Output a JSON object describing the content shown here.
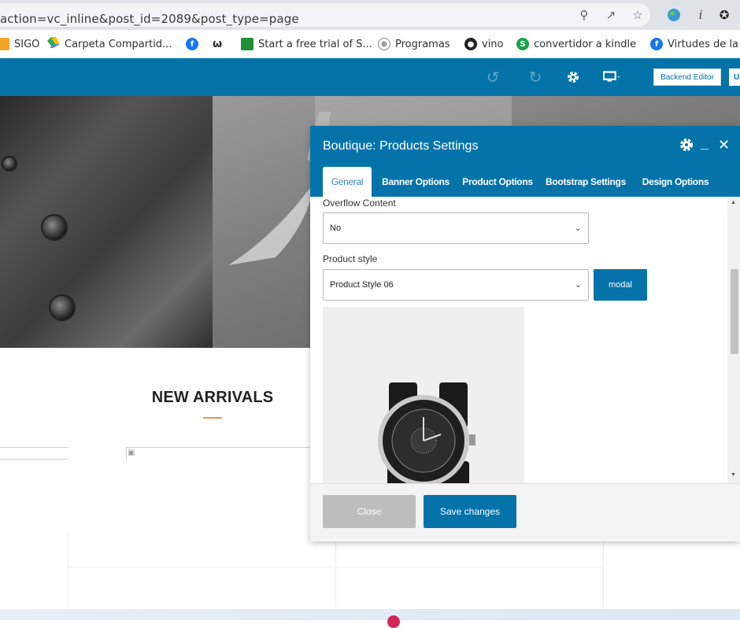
{
  "browser": {
    "url": "action=vc_inline&post_id=2089&post_type=page",
    "bookmarks": [
      {
        "label": "SIGO",
        "icon": "bookmark-icon"
      },
      {
        "label": "Carpeta Compartid...",
        "icon": "google-drive-icon"
      },
      {
        "label": "",
        "icon": "facebook-icon"
      },
      {
        "label": "",
        "icon": "brand-icon"
      },
      {
        "label": "Start a free trial of S...",
        "icon": "app-icon"
      },
      {
        "label": "Programas",
        "icon": "globe-icon"
      },
      {
        "label": "vino",
        "icon": "globe-icon"
      },
      {
        "label": "convertidor a kindle",
        "icon": "s-icon"
      },
      {
        "label": "Virtudes de la",
        "icon": "facebook-icon"
      }
    ]
  },
  "toolbar": {
    "backend_editor": "Backend Editor",
    "update": "U"
  },
  "page": {
    "section_title": "NEW ARRIVALS"
  },
  "modal": {
    "title": "Boutique: Products Settings",
    "tabs": [
      "General",
      "Banner Options",
      "Product Options",
      "Bootstrap Settings",
      "Design Options"
    ],
    "active_tab": "General",
    "overflow_label": "Overflow Content",
    "overflow_value": "No",
    "style_label": "Product style",
    "style_value": "Product Style 06",
    "modal_button": "modal",
    "close_button": "Close",
    "save_button": "Save changes"
  },
  "colors": {
    "accent": "#0473aa",
    "gold": "#c9a64a"
  }
}
